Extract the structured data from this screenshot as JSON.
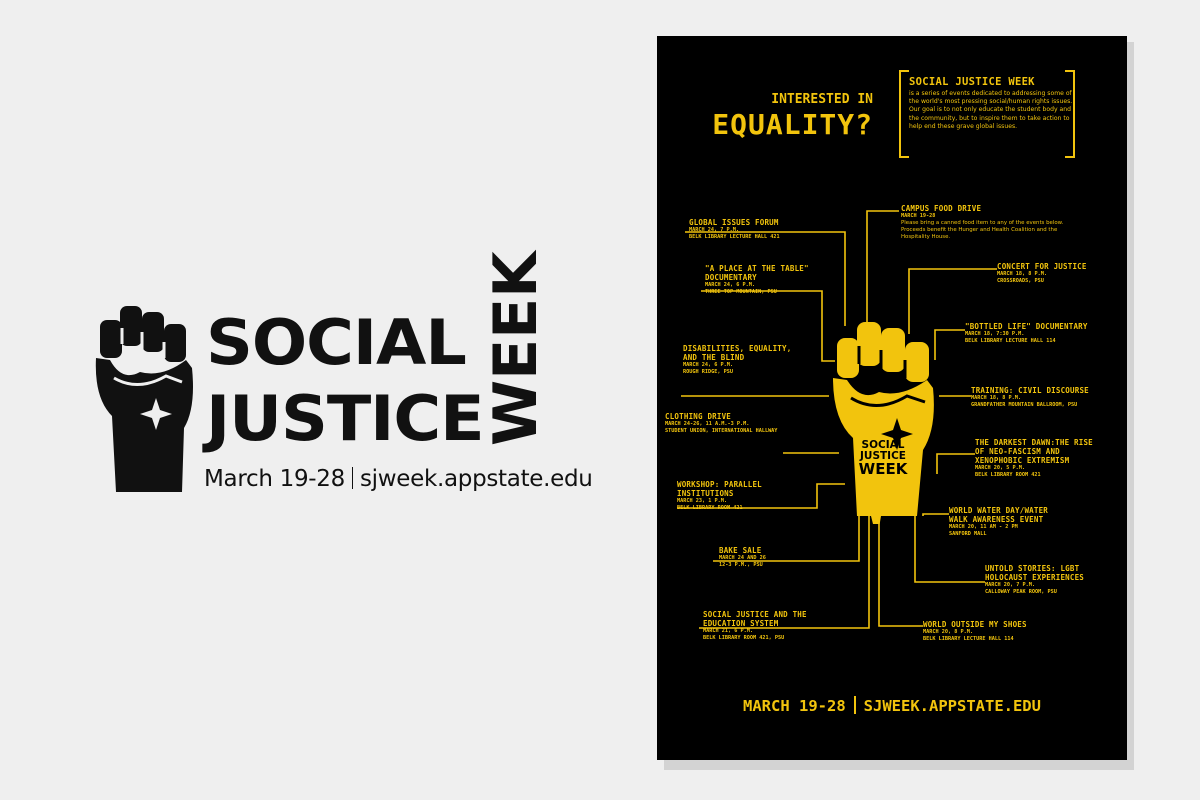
{
  "logo": {
    "line1": "SOCIAL",
    "line2": "JUSTICE",
    "line3": "WEEK",
    "dates": "March 19-28",
    "url": "sjweek.appstate.edu"
  },
  "poster": {
    "headline_small": "INTERESTED IN",
    "headline_big": "EQUALITY?",
    "intro_title": "SOCIAL JUSTICE WEEK",
    "intro_text": "is a series of events dedicated to addressing some of the world's most pressing social/human rights issues. Our goal is to not only educate the student body and the community, but to inspire them to take action to help end these grave global issues.",
    "fist_line1": "SOCIAL",
    "fist_line2": "JUSTICE",
    "fist_line3": "WEEK",
    "footer_dates": "MARCH 19-28",
    "footer_url": "SJWEEK.APPSTATE.EDU",
    "events_left": [
      {
        "title": "GLOBAL ISSUES FORUM",
        "lines": [
          "MARCH 24, 7 P.M.",
          "BELK LIBRARY LECTURE HALL 421"
        ]
      },
      {
        "title": "\"A PLACE AT THE TABLE\"|DOCUMENTARY",
        "lines": [
          "MARCH 24, 6 P.M.",
          "THREE TOP MOUNTAIN, PSU"
        ]
      },
      {
        "title": "DISABILITIES, EQUALITY,|AND THE BLIND",
        "lines": [
          "MARCH 24, 6 P.M.",
          "ROUGH RIDGE, PSU"
        ]
      },
      {
        "title": "CLOTHING DRIVE",
        "lines": [
          "MARCH 24-26, 11 A.M.-3 P.M.",
          "STUDENT UNION, INTERNATIONAL HALLWAY"
        ]
      },
      {
        "title": "WORKSHOP: PARALLEL|INSTITUTIONS",
        "lines": [
          "MARCH 23, 1 P.M.",
          "BELK LIBRARY ROOM 421"
        ]
      },
      {
        "title": "BAKE SALE",
        "lines": [
          "MARCH 24 AND 26",
          "12-3 P.M., PSU"
        ]
      },
      {
        "title": "SOCIAL JUSTICE AND THE|EDUCATION SYSTEM",
        "lines": [
          "MARCH 21, 6 P.M.",
          "BELK LIBRARY ROOM 421, PSU"
        ]
      }
    ],
    "events_right": [
      {
        "title": "CAMPUS FOOD DRIVE",
        "lines": [
          "MARCH 19-28"
        ],
        "desc": [
          "Please bring a canned food item to any of the events below.",
          "Proceeds benefit the Hunger and Health Coalition and the",
          "Hospitality House."
        ]
      },
      {
        "title": "CONCERT FOR JUSTICE",
        "lines": [
          "MARCH 18, 8 P.M.",
          "CROSSROADS, PSU"
        ]
      },
      {
        "title": "\"BOTTLED LIFE\" DOCUMENTARY",
        "lines": [
          "MARCH 18, 7:30 P.M.",
          "BELK LIBRARY LECTURE HALL 114"
        ]
      },
      {
        "title": "TRAINING: CIVIL DISCOURSE",
        "lines": [
          "MARCH 18, 8 P.M.",
          "GRANDFATHER MOUNTAIN BALLROOM, PSU"
        ]
      },
      {
        "title": "THE DARKEST DAWN:THE RISE|OF NEO-FASCISM AND|XENOPHOBIC EXTREMISM",
        "lines": [
          "MARCH 20, 5 P.M.",
          "BELK LIBRARY ROOM 421"
        ]
      },
      {
        "title": "WORLD WATER DAY/WATER|WALK AWARENESS EVENT",
        "lines": [
          "MARCH 20, 11 AM - 2 PM",
          "SANFORD MALL"
        ]
      },
      {
        "title": "UNTOLD STORIES: LGBT|HOLOCAUST EXPERIENCES",
        "lines": [
          "MARCH 20, 7 P.M.",
          "CALLOWAY PEAK ROOM, PSU"
        ]
      },
      {
        "title": "WORLD OUTSIDE MY SHOES",
        "lines": [
          "MARCH 20, 8 P.M.",
          "BELK LIBRARY LECTURE HALL 114"
        ]
      }
    ]
  },
  "colors": {
    "accent": "#f2c40d",
    "poster_bg": "#000000",
    "page_bg": "#efefef",
    "logo_ink": "#111111"
  }
}
